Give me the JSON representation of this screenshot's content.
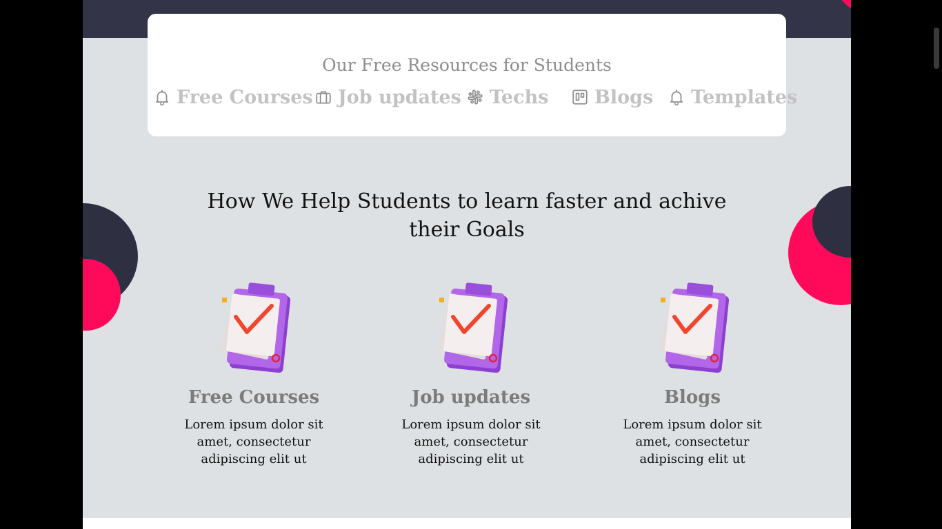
{
  "resources": {
    "title": "Our Free Resources for Students",
    "items": [
      {
        "label": "Free Courses",
        "icon": "bell-icon"
      },
      {
        "label": "Job updates",
        "icon": "briefcase-icon"
      },
      {
        "label": "Techs",
        "icon": "slack-icon"
      },
      {
        "label": "Blogs",
        "icon": "board-icon"
      },
      {
        "label": "Templates",
        "icon": "bell-icon"
      }
    ]
  },
  "help": {
    "heading": "How We Help Students to learn faster and achive their Goals",
    "features": [
      {
        "title": "Free Courses",
        "text": "Lorem ipsum dolor sit amet, consectetur adipiscing elit ut",
        "icon": "clipboard-check-icon"
      },
      {
        "title": "Job updates",
        "text": "Lorem ipsum dolor sit amet, consectetur adipiscing elit ut",
        "icon": "clipboard-check-icon"
      },
      {
        "title": "Blogs",
        "text": "Lorem ipsum dolor sit amet, consectetur adipiscing elit ut",
        "icon": "clipboard-check-icon"
      }
    ]
  },
  "colors": {
    "accent_pink": "#ff0a5b",
    "dark_navy": "#343449",
    "section_bg": "#dde1e4",
    "clipboard_purple": "#a95be0",
    "check_red": "#f0452f"
  }
}
